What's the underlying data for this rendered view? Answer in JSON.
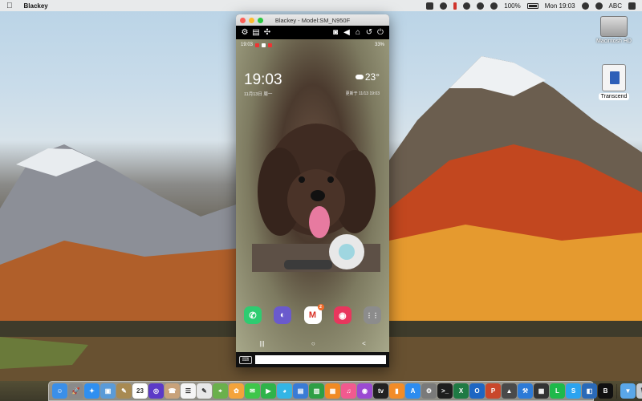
{
  "menubar": {
    "app_name": "Blackey",
    "battery": "100%",
    "clock": "Mon 19:03",
    "input_source": "ABC",
    "icons": [
      "apple-icon",
      "keyboard-icon",
      "cast-icon",
      "pause-icon",
      "bluetooth-icon",
      "wifi-icon",
      "volume-icon",
      "battery-icon",
      "search-icon",
      "user-icon",
      "input-source-icon",
      "control-center-icon"
    ]
  },
  "desktop_icons": [
    {
      "label": "Macintosh HD"
    },
    {
      "label": "Transcend"
    }
  ],
  "window": {
    "title": "Blackey - Model:SM_N950F",
    "toolbar_icons": [
      "gear-icon",
      "clipboard-icon",
      "gamepad-icon",
      "camera-icon",
      "volume-icon",
      "home-icon",
      "back-icon",
      "power-icon"
    ]
  },
  "phone": {
    "status_time": "19:03",
    "status_right": "33%",
    "lock_time": "19:03",
    "lock_date": "11月13日 周一",
    "weather_temp": "23°",
    "weather_date": "更新于 11/13 19:03",
    "apps": [
      {
        "name": "phone",
        "glyph": "✆",
        "color": "#2ecc71"
      },
      {
        "name": "internet",
        "glyph": "◐",
        "color": "#6a5acd"
      },
      {
        "name": "gmail",
        "glyph": "M",
        "color": "#ffffff",
        "badge": "2"
      },
      {
        "name": "camera",
        "glyph": "◉",
        "color": "#e8365d"
      },
      {
        "name": "apps-drawer",
        "glyph": "⋮⋮",
        "color": "#8c8c8c"
      }
    ],
    "nav": {
      "recent": "|||",
      "home": "○",
      "back": "<"
    }
  },
  "inputbar": {
    "keyboard_label": "⌨",
    "text": "",
    "placeholder": ""
  },
  "dock": {
    "items": [
      {
        "name": "finder",
        "color": "#3b8fe8",
        "glyph": "☺"
      },
      {
        "name": "launchpad",
        "color": "#8a8a8a",
        "glyph": "🚀"
      },
      {
        "name": "safari",
        "color": "#2f8ff0",
        "glyph": "✦"
      },
      {
        "name": "preview",
        "color": "#5a9bd8",
        "glyph": "▣"
      },
      {
        "name": "notes",
        "color": "#a88a52",
        "glyph": "✎"
      },
      {
        "name": "calendar",
        "color": "#ffffff",
        "glyph": "23"
      },
      {
        "name": "siri",
        "color": "#5c3ac7",
        "glyph": "◎"
      },
      {
        "name": "contacts",
        "color": "#c8a27a",
        "glyph": "☎"
      },
      {
        "name": "reminders",
        "color": "#f5f5f5",
        "glyph": "☰"
      },
      {
        "name": "textedit",
        "color": "#e8e8e8",
        "glyph": "✎"
      },
      {
        "name": "maps",
        "color": "#6ab04c",
        "glyph": "⌖"
      },
      {
        "name": "photos",
        "color": "#f3a33a",
        "glyph": "✿"
      },
      {
        "name": "messages",
        "color": "#3ec64a",
        "glyph": "✉"
      },
      {
        "name": "facetime",
        "color": "#2fb34a",
        "glyph": "▶"
      },
      {
        "name": "wechat",
        "color": "#33b5e5",
        "glyph": "◕"
      },
      {
        "name": "keynote",
        "color": "#3a7bd5",
        "glyph": "▤"
      },
      {
        "name": "numbers",
        "color": "#2e9f45",
        "glyph": "▥"
      },
      {
        "name": "pages",
        "color": "#f08a24",
        "glyph": "▦"
      },
      {
        "name": "itunes",
        "color": "#f25a8f",
        "glyph": "♫"
      },
      {
        "name": "podcasts",
        "color": "#9b4ad2",
        "glyph": "◉"
      },
      {
        "name": "apple-tv",
        "color": "#222222",
        "glyph": "tv"
      },
      {
        "name": "books",
        "color": "#f28c28",
        "glyph": "▮"
      },
      {
        "name": "app-store",
        "color": "#2d8cf0",
        "glyph": "A"
      },
      {
        "name": "system-preferences",
        "color": "#7a7a7a",
        "glyph": "⚙"
      },
      {
        "name": "terminal",
        "color": "#1e1e1e",
        "glyph": ">_"
      },
      {
        "name": "excel",
        "color": "#1f7a44",
        "glyph": "X"
      },
      {
        "name": "outlook",
        "color": "#1e66c3",
        "glyph": "O"
      },
      {
        "name": "powerpoint",
        "color": "#c9472b",
        "glyph": "P"
      },
      {
        "name": "photo-app",
        "color": "#4a4a4a",
        "glyph": "▲"
      },
      {
        "name": "xcode",
        "color": "#2d7ad6",
        "glyph": "⚒"
      },
      {
        "name": "activity",
        "color": "#333333",
        "glyph": "▦"
      },
      {
        "name": "line",
        "color": "#1eb94a",
        "glyph": "L"
      },
      {
        "name": "skype",
        "color": "#2aa3ef",
        "glyph": "S"
      },
      {
        "name": "wallet",
        "color": "#2a6ab8",
        "glyph": "◧"
      },
      {
        "name": "blackey",
        "color": "#111111",
        "glyph": "B"
      }
    ],
    "right_items": [
      {
        "name": "downloads",
        "color": "#5aa7e8",
        "glyph": "▼"
      },
      {
        "name": "trash",
        "color": "#c7ccd1",
        "glyph": "🗑"
      }
    ]
  }
}
